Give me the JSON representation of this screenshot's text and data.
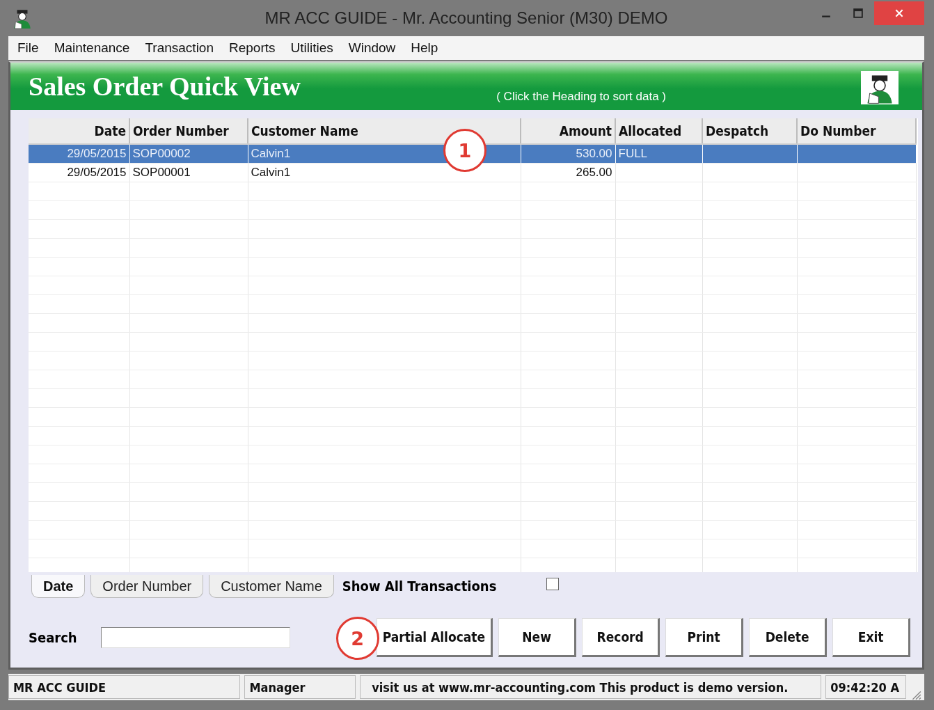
{
  "window": {
    "title": "MR ACC GUIDE - Mr. Accounting Senior (M30) DEMO"
  },
  "menu": [
    "File",
    "Maintenance",
    "Transaction",
    "Reports",
    "Utilities",
    "Window",
    "Help"
  ],
  "header": {
    "title": "Sales Order Quick View",
    "hint": "( Click the Heading to sort data )"
  },
  "table": {
    "columns": [
      "Date",
      "Order Number",
      "Customer Name",
      "Amount",
      "Allocated",
      "Despatch",
      "Do Number"
    ],
    "rows": [
      {
        "selected": true,
        "cells": [
          "29/05/2015",
          "SOP00002",
          "Calvin1",
          "530.00",
          "FULL",
          "",
          ""
        ]
      },
      {
        "selected": false,
        "cells": [
          "29/05/2015",
          "SOP00001",
          "Calvin1",
          "265.00",
          "",
          "",
          ""
        ]
      }
    ]
  },
  "sort_tabs": [
    {
      "label": "Date",
      "selected": true
    },
    {
      "label": "Order Number",
      "selected": false
    },
    {
      "label": "Customer Name",
      "selected": false
    }
  ],
  "show_all": {
    "label": "Show All Transactions",
    "checked": false
  },
  "search": {
    "label": "Search"
  },
  "buttons": [
    "Partial Allocate",
    "New",
    "Record",
    "Print",
    "Delete",
    "Exit"
  ],
  "status_bar": [
    "MR ACC GUIDE",
    "Manager",
    "visit us at www.mr-accounting.com This product is demo version.",
    "09:42:20 A"
  ],
  "callouts": [
    "1",
    "2"
  ]
}
